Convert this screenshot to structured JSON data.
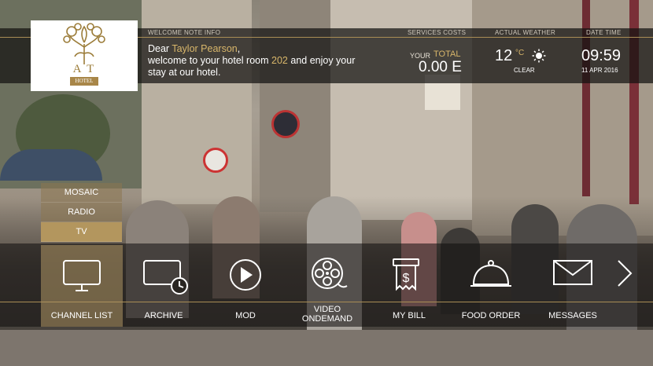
{
  "header": {
    "welcome_note_info": "WELCOME NOTE INFO",
    "services_costs": "SERVICES COSTS",
    "actual_weather": "ACTUAL WEATHER",
    "date_time": "DATE TIME"
  },
  "logo": {
    "mark": "A T",
    "subtitle": "HOTEL"
  },
  "welcome": {
    "dear": "Dear",
    "guest_name": "Taylor Pearson",
    "comma": ",",
    "line2_pre": "welcome to your hotel room",
    "room": "202",
    "line2_post": "and enjoy your",
    "line3": "stay at our hotel."
  },
  "costs": {
    "your": "YOUR",
    "total_label": "TOTAL",
    "total_value": "0.00 E"
  },
  "weather": {
    "temp": "12",
    "unit": "°C",
    "condition": "CLEAR",
    "icon": "sun-icon"
  },
  "datetime": {
    "time": "09:59",
    "date": "11 APR 2016"
  },
  "side_menu": [
    {
      "label": "MOSAIC",
      "active": false
    },
    {
      "label": "RADIO",
      "active": false
    },
    {
      "label": "TV",
      "active": true
    }
  ],
  "dock": [
    {
      "label": "CHANNEL LIST",
      "icon": "monitor-icon",
      "active": true
    },
    {
      "label": "ARCHIVE",
      "icon": "archive-clock-icon",
      "active": false
    },
    {
      "label": "MOD",
      "icon": "play-circle-icon",
      "active": false
    },
    {
      "label": "VIDEO ONDEMAND",
      "label_line1": "VIDEO",
      "label_line2": "ONDEMAND",
      "icon": "film-reel-icon",
      "active": false
    },
    {
      "label": "MY BILL",
      "icon": "bill-icon",
      "active": false
    },
    {
      "label": "FOOD ORDER",
      "icon": "food-cloche-icon",
      "active": false
    },
    {
      "label": "MESSAGES",
      "icon": "envelope-icon",
      "active": false
    }
  ],
  "colors": {
    "accent_gold": "#d8b66a",
    "line_gold": "#a98d55",
    "active_tile": "#b3965e"
  }
}
